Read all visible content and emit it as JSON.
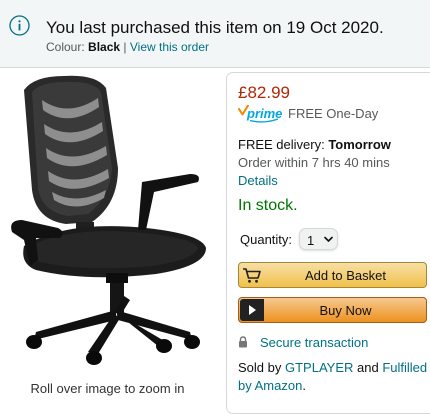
{
  "notice": {
    "icon": "info-icon",
    "title": "You last purchased this item on 19 Oct 2020.",
    "colour_label": "Colour:",
    "colour_value": "Black",
    "separator": "|",
    "view_order_link": "View this order"
  },
  "product": {
    "image": "black-mesh-office-chair",
    "zoom_caption": "Roll over image to zoom in"
  },
  "buybox": {
    "price": "£82.99",
    "prime_logo": "prime",
    "prime_text": "FREE One-Day",
    "delivery_prefix": "FREE delivery:",
    "delivery_day": "Tomorrow",
    "order_within": "Order within 7 hrs 40 mins",
    "details_link": "Details",
    "stock": "In stock.",
    "quantity_label": "Quantity:",
    "quantity_value": "1",
    "add_to_basket": "Add to Basket",
    "buy_now": "Buy Now",
    "secure_transaction": "Secure transaction",
    "sold_by_prefix": "Sold by",
    "seller": "GTPLAYER",
    "and_text": "and",
    "fulfilled_link": "Fulfilled by Amazon",
    "period": "."
  },
  "colors": {
    "price": "#b12704",
    "stock": "#007600",
    "link": "#007185",
    "prime_blue": "#00a8e1",
    "basket_button": "#f0c14b",
    "buy_now_button": "#ed9220"
  }
}
